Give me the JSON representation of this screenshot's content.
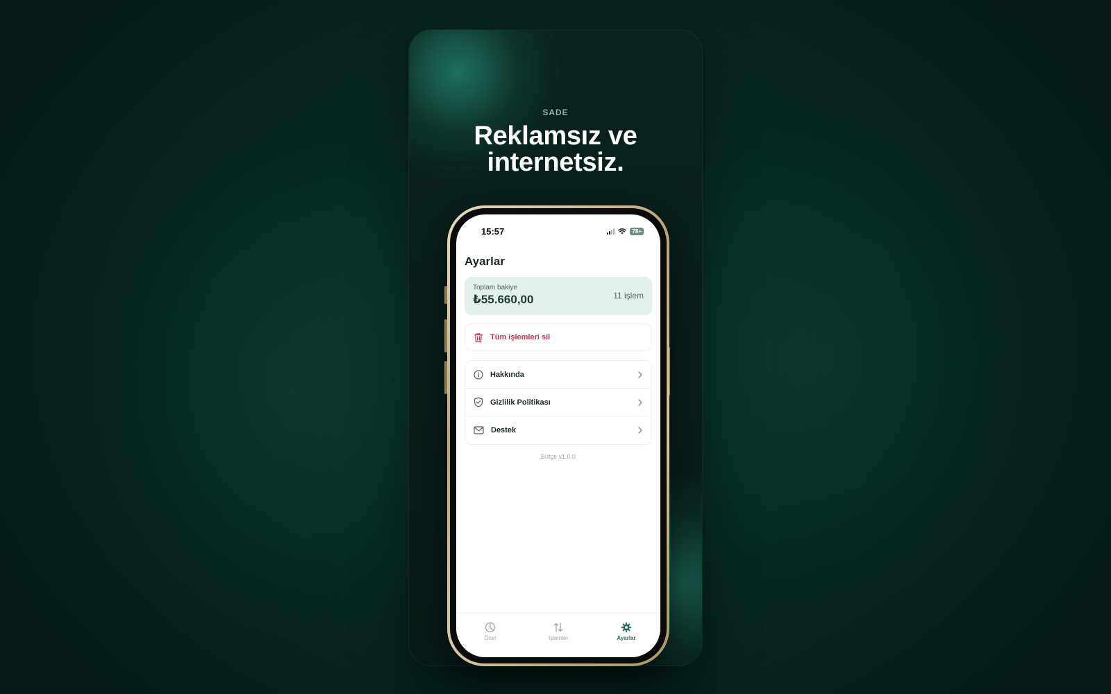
{
  "promo": {
    "eyebrow": "SADE",
    "headline": "Reklamsız ve internetsiz."
  },
  "phone": {
    "status_bar": {
      "time": "15:57",
      "battery": "78+"
    },
    "screen": {
      "title": "Ayarlar",
      "balance_card": {
        "label": "Toplam bakiye",
        "value": "₺55.660,00",
        "transaction_count": "11 işlem"
      },
      "delete_all": {
        "label": "Tüm işlemleri sil",
        "icon": "trash-icon"
      },
      "menu": [
        {
          "label": "Hakkında",
          "icon": "info-icon"
        },
        {
          "label": "Gizlilik Politikası",
          "icon": "shield-check-icon"
        },
        {
          "label": "Destek",
          "icon": "mail-icon"
        }
      ],
      "version": "Bütçe v1.0.0"
    },
    "tab_bar": [
      {
        "label": "Özet",
        "icon": "pie-chart-icon",
        "active": false
      },
      {
        "label": "İşlemler",
        "icon": "arrows-updown-icon",
        "active": false
      },
      {
        "label": "Ayarlar",
        "icon": "gear-icon",
        "active": true
      }
    ]
  },
  "colors": {
    "accent": "#2f6b5d",
    "danger": "#c83254",
    "card_bg": "#e3f0ec"
  }
}
